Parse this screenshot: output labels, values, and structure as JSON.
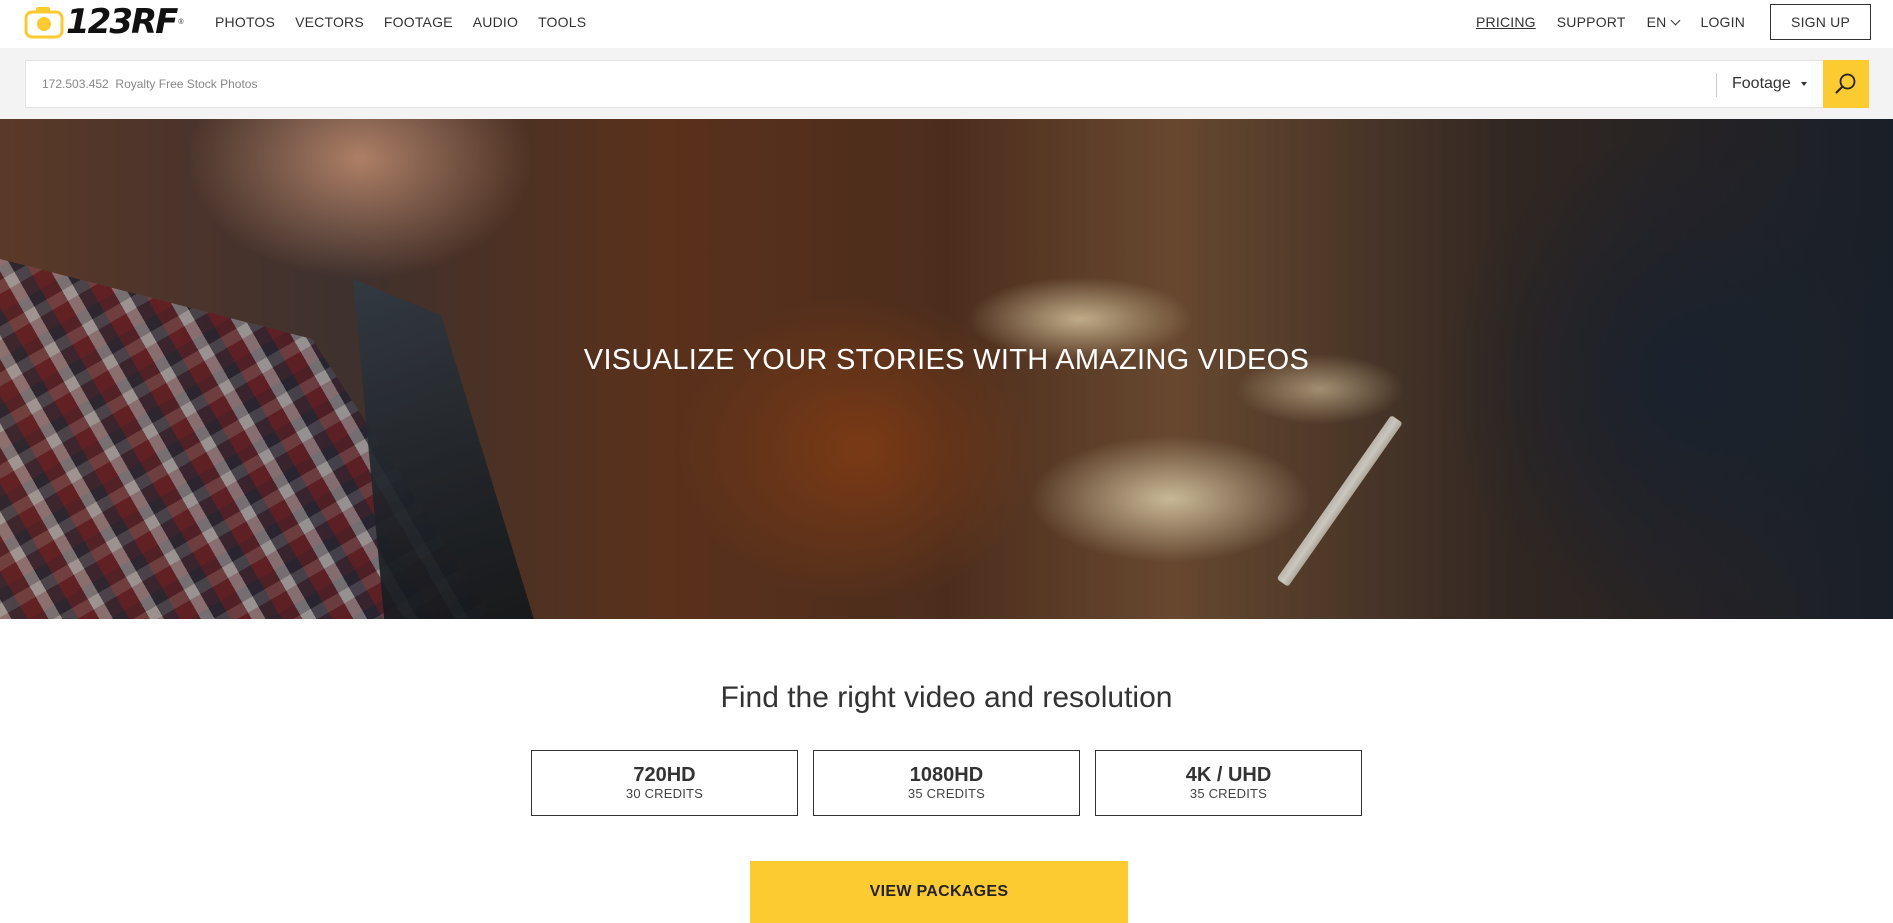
{
  "brand": {
    "logo_text": "123RF",
    "colors": {
      "accent": "#fccb2f",
      "text": "#333333"
    }
  },
  "nav": {
    "left": [
      "PHOTOS",
      "VECTORS",
      "FOOTAGE",
      "AUDIO",
      "TOOLS"
    ],
    "right": {
      "pricing": "PRICING",
      "support": "SUPPORT",
      "lang": "EN",
      "login": "LOGIN",
      "signup": "SIGN UP"
    }
  },
  "search": {
    "placeholder": "172.503.452  Royalty Free Stock Photos",
    "type_selected": "Footage",
    "icon": "search-icon"
  },
  "hero": {
    "title": "VISUALIZE YOUR STORIES WITH AMAZING VIDEOS"
  },
  "resolutions": {
    "heading": "Find the right video and resolution",
    "items": [
      {
        "name": "720HD",
        "credits": "30 CREDITS"
      },
      {
        "name": "1080HD",
        "credits": "35 CREDITS"
      },
      {
        "name": "4K / UHD",
        "credits": "35 CREDITS"
      }
    ],
    "cta": "VIEW PACKAGES"
  }
}
